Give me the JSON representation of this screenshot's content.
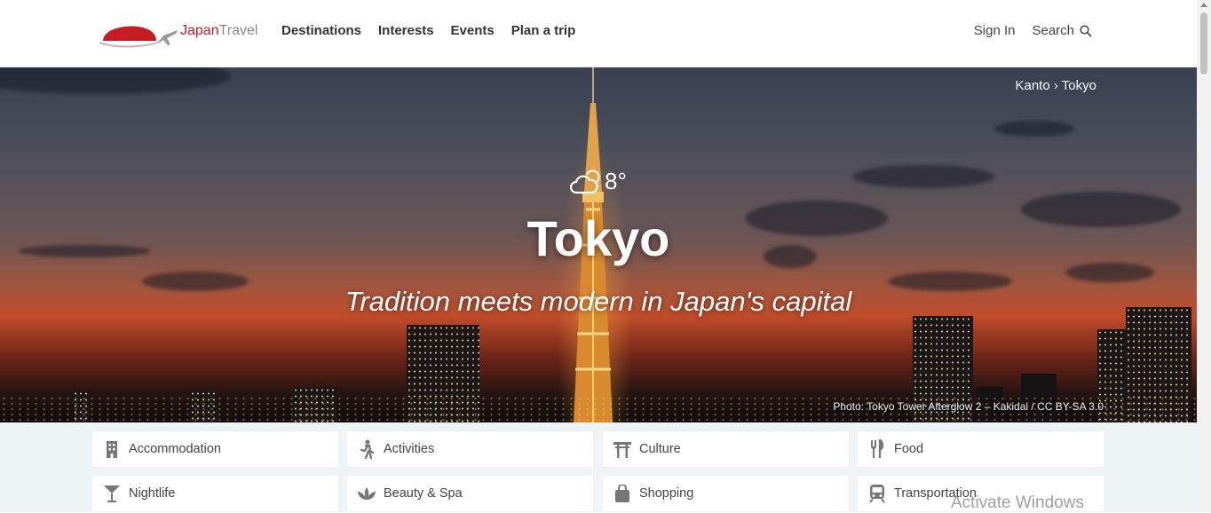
{
  "header": {
    "logo": {
      "text_japan": "Japan",
      "text_travel": "Travel",
      "icon": "japan-travel-logo"
    },
    "nav": [
      {
        "label": "Destinations"
      },
      {
        "label": "Interests"
      },
      {
        "label": "Events"
      },
      {
        "label": "Plan a trip"
      }
    ],
    "sign_in": "Sign In",
    "search": "Search",
    "search_icon": "search-icon"
  },
  "hero": {
    "breadcrumb": "Kanto › Tokyo",
    "weather": {
      "icon": "partly-cloudy-icon",
      "temperature": "8°"
    },
    "title": "Tokyo",
    "tagline": "Tradition meets modern in Japan's capital",
    "photo_credit": "Photo: Tokyo Tower Afterglow 2 – Kakidai / CC BY-SA 3.0"
  },
  "categories": [
    {
      "label": "Accommodation",
      "icon": "building-icon"
    },
    {
      "label": "Activities",
      "icon": "walking-person-icon"
    },
    {
      "label": "Culture",
      "icon": "torii-gate-icon"
    },
    {
      "label": "Food",
      "icon": "fork-knife-icon"
    },
    {
      "label": "Nightlife",
      "icon": "cocktail-glass-icon"
    },
    {
      "label": "Beauty & Spa",
      "icon": "lotus-icon"
    },
    {
      "label": "Shopping",
      "icon": "shopping-bag-icon"
    },
    {
      "label": "Transportation",
      "icon": "train-icon"
    }
  ],
  "watermark": "Activate Windows",
  "colors": {
    "brand_red": "#c61c22",
    "header_bg": "#ffffff",
    "category_bg": "#eef3f6"
  }
}
